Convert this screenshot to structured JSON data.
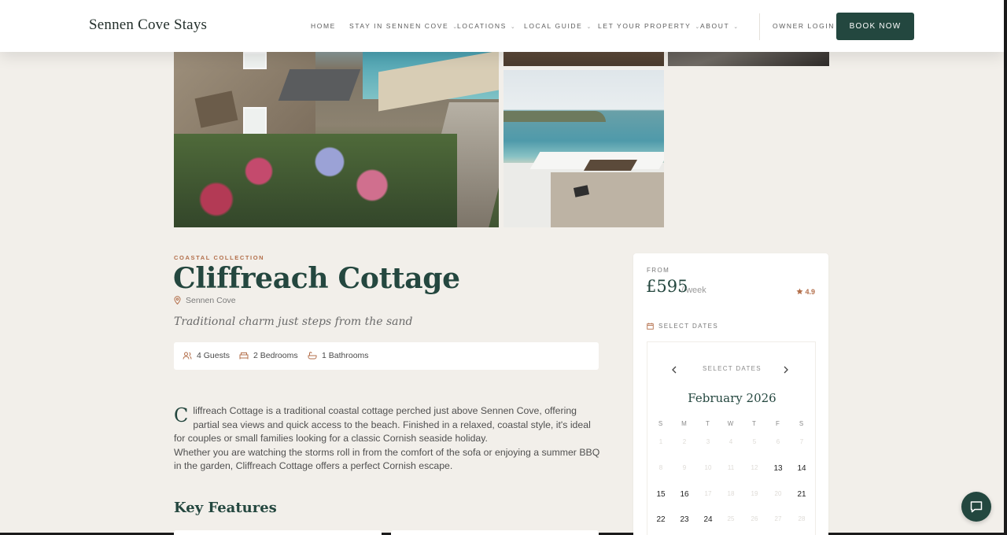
{
  "header": {
    "brand": "Sennen Cove Stays",
    "nav": [
      {
        "label": "HOME",
        "has_menu": false
      },
      {
        "label": "STAY IN SENNEN COVE",
        "has_menu": true
      },
      {
        "label": "LOCATIONS",
        "has_menu": true
      },
      {
        "label": "LOCAL GUIDE",
        "has_menu": true
      },
      {
        "label": "LET YOUR PROPERTY",
        "has_menu": true
      },
      {
        "label": "ABOUT",
        "has_menu": true
      }
    ],
    "owner_login": "OWNER LOGIN",
    "book_now": "BOOK NOW",
    "chevron": "⌄"
  },
  "listing": {
    "collection": "COASTAL COLLECTION",
    "title": "Cliffreach Cottage",
    "location": "Sennen Cove",
    "tagline": "Traditional charm just steps from the sand",
    "specs": {
      "guests": "4 Guests",
      "bedrooms": "2 Bedrooms",
      "bathrooms": "1 Bathrooms"
    },
    "description": {
      "dropcap": "C",
      "p1": "liffreach Cottage is a traditional coastal cottage perched just above Sennen Cove, offering partial sea views and quick access to the beach. Finished in a relaxed, coastal style, it's ideal for couples or small families looking for a classic Cornish seaside holiday.",
      "p2": "Whether you are watching the storms roll in from the comfort of the sofa or enjoying a summer BBQ in the garden, Cliffreach Cottage offers a perfect Cornish escape."
    },
    "key_features_heading": "Key Features"
  },
  "booking": {
    "from_label": "FROM",
    "price": "£595",
    "per": "/ week",
    "rating": "4.9",
    "select_dates_label": "SELECT DATES",
    "calendar": {
      "header": "SELECT DATES",
      "prev": "‹",
      "next": "›",
      "month": "February 2026",
      "weekdays": [
        "S",
        "M",
        "T",
        "W",
        "T",
        "F",
        "S"
      ],
      "weeks": [
        [
          {
            "d": "1",
            "available": false
          },
          {
            "d": "2",
            "available": false
          },
          {
            "d": "3",
            "available": false
          },
          {
            "d": "4",
            "available": false
          },
          {
            "d": "5",
            "available": false
          },
          {
            "d": "6",
            "available": false
          },
          {
            "d": "7",
            "available": false
          }
        ],
        [
          {
            "d": "8",
            "available": false
          },
          {
            "d": "9",
            "available": false
          },
          {
            "d": "10",
            "available": false
          },
          {
            "d": "11",
            "available": false
          },
          {
            "d": "12",
            "available": false
          },
          {
            "d": "13",
            "available": true
          },
          {
            "d": "14",
            "available": true
          }
        ],
        [
          {
            "d": "15",
            "available": true
          },
          {
            "d": "16",
            "available": true
          },
          {
            "d": "17",
            "available": false
          },
          {
            "d": "18",
            "available": false
          },
          {
            "d": "19",
            "available": false
          },
          {
            "d": "20",
            "available": false
          },
          {
            "d": "21",
            "available": true
          }
        ],
        [
          {
            "d": "22",
            "available": true
          },
          {
            "d": "23",
            "available": true
          },
          {
            "d": "24",
            "available": true
          },
          {
            "d": "25",
            "available": false
          },
          {
            "d": "26",
            "available": false
          },
          {
            "d": "27",
            "available": false
          },
          {
            "d": "28",
            "available": false
          }
        ]
      ]
    }
  },
  "colors": {
    "brand_green": "#23473f",
    "accent_terracotta": "#b36f4b",
    "page_bg": "#f2efea"
  },
  "icons": {
    "location": "map-pin-icon",
    "guests": "users-icon",
    "bedrooms": "bed-icon",
    "bathrooms": "bath-icon",
    "rating": "star-icon",
    "dates": "calendar-icon",
    "chat": "chat-bubble-icon"
  }
}
